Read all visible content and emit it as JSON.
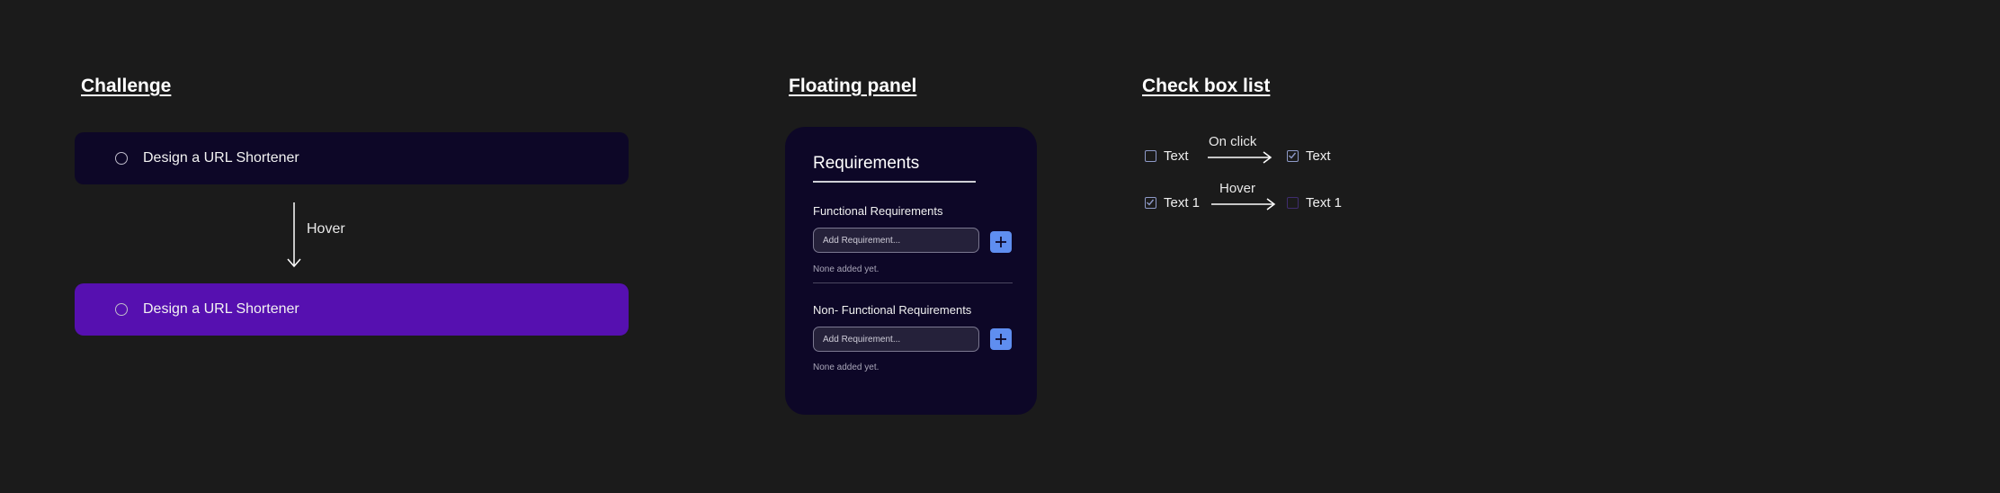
{
  "challenge": {
    "section_title": "Challenge",
    "default_item": {
      "label": "Design a URL Shortener"
    },
    "hover_label": "Hover",
    "hover_item": {
      "label": "Design a URL Shortener"
    }
  },
  "floating_panel": {
    "section_title": "Floating panel",
    "title": "Requirements",
    "groups": [
      {
        "heading": "Functional Requirements",
        "placeholder": "Add Requirement...",
        "empty_text": "None added yet."
      },
      {
        "heading": "Non- Functional Requirements",
        "placeholder": "Add Requirement...",
        "empty_text": "None added yet."
      }
    ]
  },
  "checkbox_list": {
    "section_title": "Check box list",
    "rows": [
      {
        "from_label": "Text",
        "transition": "On click",
        "to_label": "Text"
      },
      {
        "from_label": "Text 1",
        "transition": "Hover",
        "to_label": "Text 1"
      }
    ]
  },
  "colors": {
    "background": "#1b1b1b",
    "bar_default": "#0d0727",
    "bar_hover": "#5610b0",
    "panel": "#0d0727",
    "accent_button": "#5f8ef0"
  }
}
